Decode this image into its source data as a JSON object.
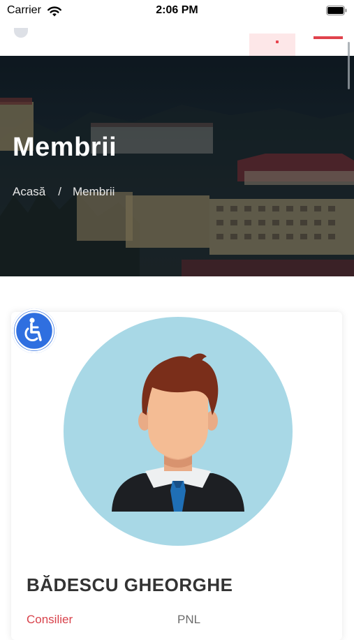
{
  "status_bar": {
    "carrier": "Carrier",
    "time": "2:06 PM"
  },
  "hero": {
    "title": "Membrii",
    "breadcrumb": {
      "home": "Acasă",
      "separator": "/",
      "current": "Membrii"
    }
  },
  "member": {
    "name": "BĂDESCU GHEORGHE",
    "role": "Consilier",
    "party": "PNL"
  },
  "colors": {
    "accent_red": "#d8424b",
    "accessibility_blue": "#2f6fe0",
    "avatar_bg": "#a8d8e6"
  },
  "icons": {
    "wifi": "wifi-icon",
    "battery": "battery-icon",
    "accessibility": "accessibility-icon",
    "menu": "menu-icon"
  }
}
